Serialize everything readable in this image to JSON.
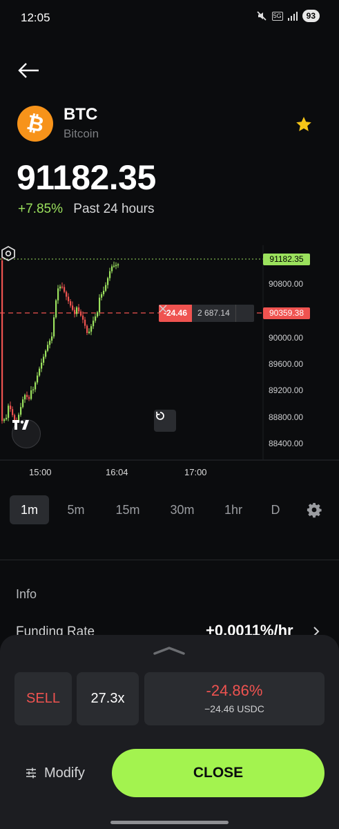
{
  "status_bar": {
    "time": "12:05",
    "network": "5G",
    "battery": "93"
  },
  "asset": {
    "symbol": "BTC",
    "name": "Bitcoin",
    "logo_glyph": "₿",
    "logo_color": "#f7931a",
    "favorited": true
  },
  "price": "91182.35",
  "change": {
    "percent": "+7.85%",
    "period": "Past 24 hours",
    "color": "#9be15d"
  },
  "chart": {
    "y_labels": [
      "90800.00",
      "90000.00",
      "89600.00",
      "89200.00",
      "88800.00",
      "88400.00"
    ],
    "current_price_tag": "91182.35",
    "entry_price_tag": "90359.38",
    "position_pnl": "-24.46",
    "position_size": "2 687.14",
    "x_labels": [
      "15:00",
      "16:04",
      "17:00"
    ],
    "up_color": "#9be15d",
    "down_color": "#ef5350"
  },
  "timeframes": [
    "1m",
    "5m",
    "15m",
    "30m",
    "1hr",
    "D"
  ],
  "active_timeframe": "1m",
  "info": {
    "title": "Info",
    "funding_label": "Funding Rate",
    "funding_value": "+0.0011%/hr"
  },
  "position": {
    "side": "SELL",
    "leverage": "27.3x",
    "pnl_percent": "-24.86%",
    "pnl_usd": "−24.46 USDC",
    "modify_label": "Modify",
    "close_label": "CLOSE",
    "accent": "#a3f34f"
  }
}
